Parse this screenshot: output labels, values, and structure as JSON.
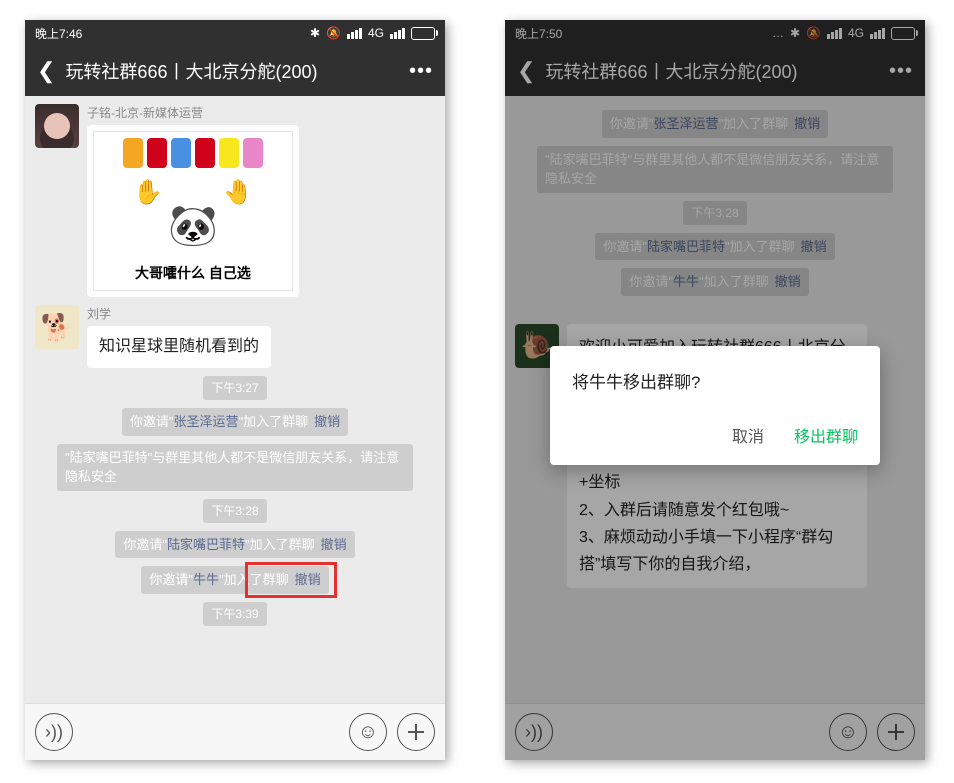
{
  "phone1": {
    "status": {
      "time": "晚上7:46",
      "network": "4G"
    },
    "header": {
      "title": "玩转社群666丨大北京分舵",
      "count": "(200)"
    },
    "messages": {
      "m1_sender": "子铭-北京-新媒体运营",
      "m1_meme_text": "大哥嚯什么 自己选",
      "m2_sender": "刘学",
      "m2_text": "知识星球里随机看到的",
      "time1": "下午3:27",
      "sys1_prefix": "你邀请\"",
      "sys1_name": "张圣泽运营",
      "sys1_suffix": "\"加入了群聊",
      "sys1_revoke": "撤销",
      "sys2": "\"陆家嘴巴菲特\"与群里其他人都不是微信朋友关系，请注意隐私安全",
      "time2": "下午3:28",
      "sys3_prefix": "你邀请\"",
      "sys3_name": "陆家嘴巴菲特",
      "sys3_suffix": "\"加入了群聊",
      "sys3_revoke": "撤销",
      "sys4_prefix": "你邀请\"",
      "sys4_name": "牛牛",
      "sys4_suffix": "\"加入了群聊",
      "sys4_revoke": "撤销",
      "time3": "下午3:39"
    }
  },
  "phone2": {
    "status": {
      "time": "晚上7:50",
      "network": "4G"
    },
    "header": {
      "title": "玩转社群666丨大北京分舵",
      "count": "(200)"
    },
    "dim_messages": {
      "sys1_prefix": "你邀请\"",
      "sys1_name": "张圣泽运营",
      "sys1_suffix": "\"加入了群聊",
      "sys1_revoke": "撤销",
      "sys2": "\"陆家嘴巴菲特\"与群里其他人都不是微信朋友关系，请注意隐私安全",
      "time1": "下午3:28",
      "sys3_prefix": "你邀请\"",
      "sys3_name": "陆家嘴巴菲特",
      "sys3_suffix": "\"加入了群聊",
      "sys3_revoke": "撤销",
      "sys4_prefix": "你邀请\"",
      "sys4_name": "牛牛",
      "sys4_suffix": "\"加入了群聊",
      "sys4_revoke": "撤销",
      "long_msg": "欢迎小可爱加入玩转社群666丨北京分舵❤️\n\n入群有三件小事要完成~\n1、请把你的群昵称修改为；昵称+行业+坐标\n2、入群后请随意发个红包哦~\n3、麻烦动动小手填一下小程序“群勾搭”填写下你的自我介绍，"
    },
    "dialog": {
      "message": "将牛牛移出群聊?",
      "cancel": "取消",
      "confirm": "移出群聊"
    }
  }
}
